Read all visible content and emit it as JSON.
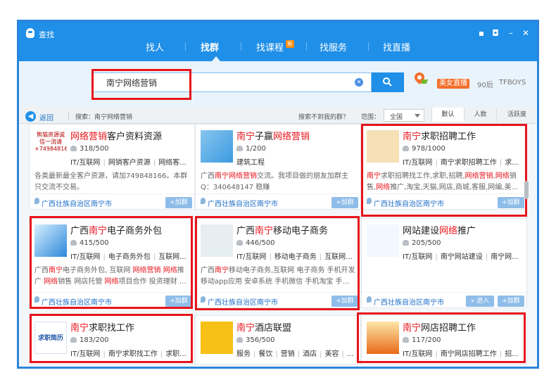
{
  "window": {
    "title": "查找"
  },
  "nav": {
    "tabs": [
      "找人",
      "找群",
      "找课程",
      "找服务",
      "找直播"
    ],
    "active": "找群",
    "new_badge": "新"
  },
  "search": {
    "value": "南宁网络营销",
    "button_icon": "search-icon"
  },
  "hot": {
    "live_label": "美女直播",
    "tags": [
      "90后",
      "TFBOYS"
    ]
  },
  "filter": {
    "back_label": "返回",
    "query_text": "搜索：南宁网络营销",
    "not_found_text": "搜索不到我的群？",
    "range_label": "范围：",
    "range_value": "全国",
    "sort_options": [
      "默认",
      "人数",
      "活跃度"
    ]
  },
  "common": {
    "join_label": "+加群",
    "enter_label": "» 进入"
  },
  "groups": [
    {
      "title_pre": "",
      "title_kw": "网络营销",
      "title_post": "客户资料资源",
      "members": "318/500",
      "tags": [
        "IT/互联网",
        "网销客户资源",
        "网络客..."
      ],
      "desc": [
        {
          "t": "各类最新最全客户资源，请加749848166。本群只交流不交易。"
        }
      ],
      "location": "广西壮族自治区南宁市",
      "poster_text": "熊猫资源诚信一流请+749848166"
    },
    {
      "title_pre": "",
      "title_kw": "南宁",
      "title_post": "子赢",
      "title_kw2": "网络营销",
      "members": "1/200",
      "tags": [
        "建筑工程"
      ],
      "desc": [
        {
          "t": "广西"
        },
        {
          "t": "南宁网络营销",
          "kw": true
        },
        {
          "t": "交流。我项目做的朋友加群主Q：340648147 稳赚"
        }
      ],
      "location": "广西壮族自治区南宁市"
    },
    {
      "title_pre": "",
      "title_kw": "南宁",
      "title_post": "求职招聘工作",
      "members": "978/1000",
      "tags": [
        "IT/互联网",
        "南宁求职招聘工作",
        "求..."
      ],
      "desc": [
        {
          "t": "南宁",
          "kw": true
        },
        {
          "t": "求职招聘找工作,求职,招聘,"
        },
        {
          "t": "网络营销",
          "kw": true
        },
        {
          "t": ","
        },
        {
          "t": "网络",
          "kw": true
        },
        {
          "t": "销售,"
        },
        {
          "t": "网络",
          "kw": true
        },
        {
          "t": "推广,淘宝,天猫,网店,商城,客服,网编,美..."
        }
      ],
      "location": "广西壮族自治区南宁市"
    },
    {
      "title_pre": "广西",
      "title_kw": "南宁",
      "title_post": "电子商务外包",
      "members": "415/500",
      "tags": [
        "IT/互联网",
        "电子商务外包",
        "互联网..."
      ],
      "desc": [
        {
          "t": "广西"
        },
        {
          "t": "南宁",
          "kw": true
        },
        {
          "t": "电子商务外包, 互联网 "
        },
        {
          "t": "网络营销 网络",
          "kw": true
        },
        {
          "t": "推广 "
        },
        {
          "t": "网络",
          "kw": true
        },
        {
          "t": "销售 网店托管 "
        },
        {
          "t": "网络",
          "kw": true
        },
        {
          "t": "项目合作 投资理财 ..."
        }
      ],
      "location": "广西壮族自治区南宁市"
    },
    {
      "title_pre": "广西",
      "title_kw": "南宁",
      "title_post": "移动电子商务",
      "members": "446/500",
      "tags": [
        "IT/互联网",
        "移动电子商务",
        "互联网..."
      ],
      "desc": [
        {
          "t": "广西"
        },
        {
          "t": "南宁",
          "kw": true
        },
        {
          "t": "移动电子商务,互联网 电子商务 手机开发 移动app应用 安卓系统 手机微信 手机淘宝 手..."
        }
      ],
      "location": "广西壮族自治区南宁市"
    },
    {
      "title_pre": "网站建设",
      "title_kw": "网络",
      "title_post": "推广",
      "members": "205/500",
      "tags": [
        "IT/互联网",
        "南宁网站建设",
        "南宁网..."
      ],
      "desc": [],
      "location": "广西壮族自治区南宁市"
    },
    {
      "title_pre": "",
      "title_kw": "南宁",
      "title_post": "求职找工作",
      "members": "183/200",
      "tags": [
        "IT/互联网",
        "南宁求职找工作",
        "求职..."
      ],
      "desc": [],
      "location": "",
      "poster_text": "求职简历"
    },
    {
      "title_pre": "",
      "title_kw": "南宁",
      "title_post": "酒店联盟",
      "members": "356/500",
      "tags": [
        "服务",
        "餐饮",
        "营销",
        "酒店",
        "美容",
        "..."
      ],
      "desc": [],
      "location": ""
    },
    {
      "title_pre": "",
      "title_kw": "南宁",
      "title_post": "网店招聘工作",
      "members": "117/200",
      "tags": [
        "IT/互联网",
        "南宁网店招聘工作",
        "招..."
      ],
      "desc": [],
      "location": ""
    }
  ],
  "colors": {
    "brand": "#1f8fe8",
    "highlight": "#e8141b",
    "keyword": "#e8141b",
    "link": "#1e6fc8"
  }
}
